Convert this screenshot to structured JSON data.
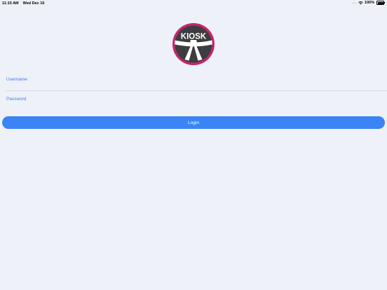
{
  "status_bar": {
    "time": "11:15 AM",
    "date": "Wed Dec 16",
    "signal": "....",
    "battery_percent_text": "100%",
    "battery_level": 1.0
  },
  "logo": {
    "text": "KIOSK",
    "colors": {
      "ring": "#c3266c",
      "fill": "#3d3d3f",
      "belt": "#ffffff"
    }
  },
  "form": {
    "username_label": "Username",
    "username_value": "",
    "password_label": "Password",
    "password_value": "",
    "login_label": "Login"
  },
  "colors": {
    "accent": "#3a84f5",
    "label": "#3a7cf0",
    "background": "#eff1f8"
  }
}
